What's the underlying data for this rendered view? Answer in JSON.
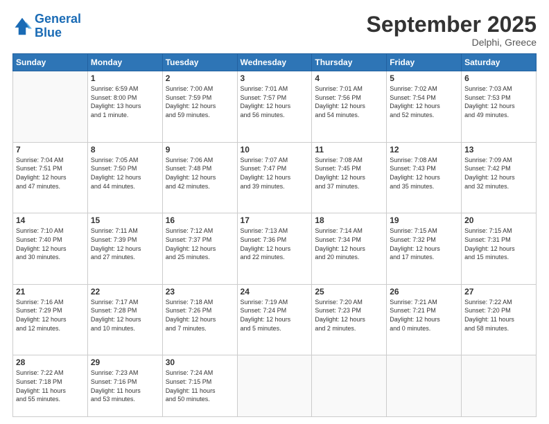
{
  "logo": {
    "line1": "General",
    "line2": "Blue"
  },
  "title": "September 2025",
  "subtitle": "Delphi, Greece",
  "weekdays": [
    "Sunday",
    "Monday",
    "Tuesday",
    "Wednesday",
    "Thursday",
    "Friday",
    "Saturday"
  ],
  "weeks": [
    [
      {
        "day": "",
        "info": ""
      },
      {
        "day": "1",
        "info": "Sunrise: 6:59 AM\nSunset: 8:00 PM\nDaylight: 13 hours\nand 1 minute."
      },
      {
        "day": "2",
        "info": "Sunrise: 7:00 AM\nSunset: 7:59 PM\nDaylight: 12 hours\nand 59 minutes."
      },
      {
        "day": "3",
        "info": "Sunrise: 7:01 AM\nSunset: 7:57 PM\nDaylight: 12 hours\nand 56 minutes."
      },
      {
        "day": "4",
        "info": "Sunrise: 7:01 AM\nSunset: 7:56 PM\nDaylight: 12 hours\nand 54 minutes."
      },
      {
        "day": "5",
        "info": "Sunrise: 7:02 AM\nSunset: 7:54 PM\nDaylight: 12 hours\nand 52 minutes."
      },
      {
        "day": "6",
        "info": "Sunrise: 7:03 AM\nSunset: 7:53 PM\nDaylight: 12 hours\nand 49 minutes."
      }
    ],
    [
      {
        "day": "7",
        "info": "Sunrise: 7:04 AM\nSunset: 7:51 PM\nDaylight: 12 hours\nand 47 minutes."
      },
      {
        "day": "8",
        "info": "Sunrise: 7:05 AM\nSunset: 7:50 PM\nDaylight: 12 hours\nand 44 minutes."
      },
      {
        "day": "9",
        "info": "Sunrise: 7:06 AM\nSunset: 7:48 PM\nDaylight: 12 hours\nand 42 minutes."
      },
      {
        "day": "10",
        "info": "Sunrise: 7:07 AM\nSunset: 7:47 PM\nDaylight: 12 hours\nand 39 minutes."
      },
      {
        "day": "11",
        "info": "Sunrise: 7:08 AM\nSunset: 7:45 PM\nDaylight: 12 hours\nand 37 minutes."
      },
      {
        "day": "12",
        "info": "Sunrise: 7:08 AM\nSunset: 7:43 PM\nDaylight: 12 hours\nand 35 minutes."
      },
      {
        "day": "13",
        "info": "Sunrise: 7:09 AM\nSunset: 7:42 PM\nDaylight: 12 hours\nand 32 minutes."
      }
    ],
    [
      {
        "day": "14",
        "info": "Sunrise: 7:10 AM\nSunset: 7:40 PM\nDaylight: 12 hours\nand 30 minutes."
      },
      {
        "day": "15",
        "info": "Sunrise: 7:11 AM\nSunset: 7:39 PM\nDaylight: 12 hours\nand 27 minutes."
      },
      {
        "day": "16",
        "info": "Sunrise: 7:12 AM\nSunset: 7:37 PM\nDaylight: 12 hours\nand 25 minutes."
      },
      {
        "day": "17",
        "info": "Sunrise: 7:13 AM\nSunset: 7:36 PM\nDaylight: 12 hours\nand 22 minutes."
      },
      {
        "day": "18",
        "info": "Sunrise: 7:14 AM\nSunset: 7:34 PM\nDaylight: 12 hours\nand 20 minutes."
      },
      {
        "day": "19",
        "info": "Sunrise: 7:15 AM\nSunset: 7:32 PM\nDaylight: 12 hours\nand 17 minutes."
      },
      {
        "day": "20",
        "info": "Sunrise: 7:15 AM\nSunset: 7:31 PM\nDaylight: 12 hours\nand 15 minutes."
      }
    ],
    [
      {
        "day": "21",
        "info": "Sunrise: 7:16 AM\nSunset: 7:29 PM\nDaylight: 12 hours\nand 12 minutes."
      },
      {
        "day": "22",
        "info": "Sunrise: 7:17 AM\nSunset: 7:28 PM\nDaylight: 12 hours\nand 10 minutes."
      },
      {
        "day": "23",
        "info": "Sunrise: 7:18 AM\nSunset: 7:26 PM\nDaylight: 12 hours\nand 7 minutes."
      },
      {
        "day": "24",
        "info": "Sunrise: 7:19 AM\nSunset: 7:24 PM\nDaylight: 12 hours\nand 5 minutes."
      },
      {
        "day": "25",
        "info": "Sunrise: 7:20 AM\nSunset: 7:23 PM\nDaylight: 12 hours\nand 2 minutes."
      },
      {
        "day": "26",
        "info": "Sunrise: 7:21 AM\nSunset: 7:21 PM\nDaylight: 12 hours\nand 0 minutes."
      },
      {
        "day": "27",
        "info": "Sunrise: 7:22 AM\nSunset: 7:20 PM\nDaylight: 11 hours\nand 58 minutes."
      }
    ],
    [
      {
        "day": "28",
        "info": "Sunrise: 7:22 AM\nSunset: 7:18 PM\nDaylight: 11 hours\nand 55 minutes."
      },
      {
        "day": "29",
        "info": "Sunrise: 7:23 AM\nSunset: 7:16 PM\nDaylight: 11 hours\nand 53 minutes."
      },
      {
        "day": "30",
        "info": "Sunrise: 7:24 AM\nSunset: 7:15 PM\nDaylight: 11 hours\nand 50 minutes."
      },
      {
        "day": "",
        "info": ""
      },
      {
        "day": "",
        "info": ""
      },
      {
        "day": "",
        "info": ""
      },
      {
        "day": "",
        "info": ""
      }
    ]
  ]
}
